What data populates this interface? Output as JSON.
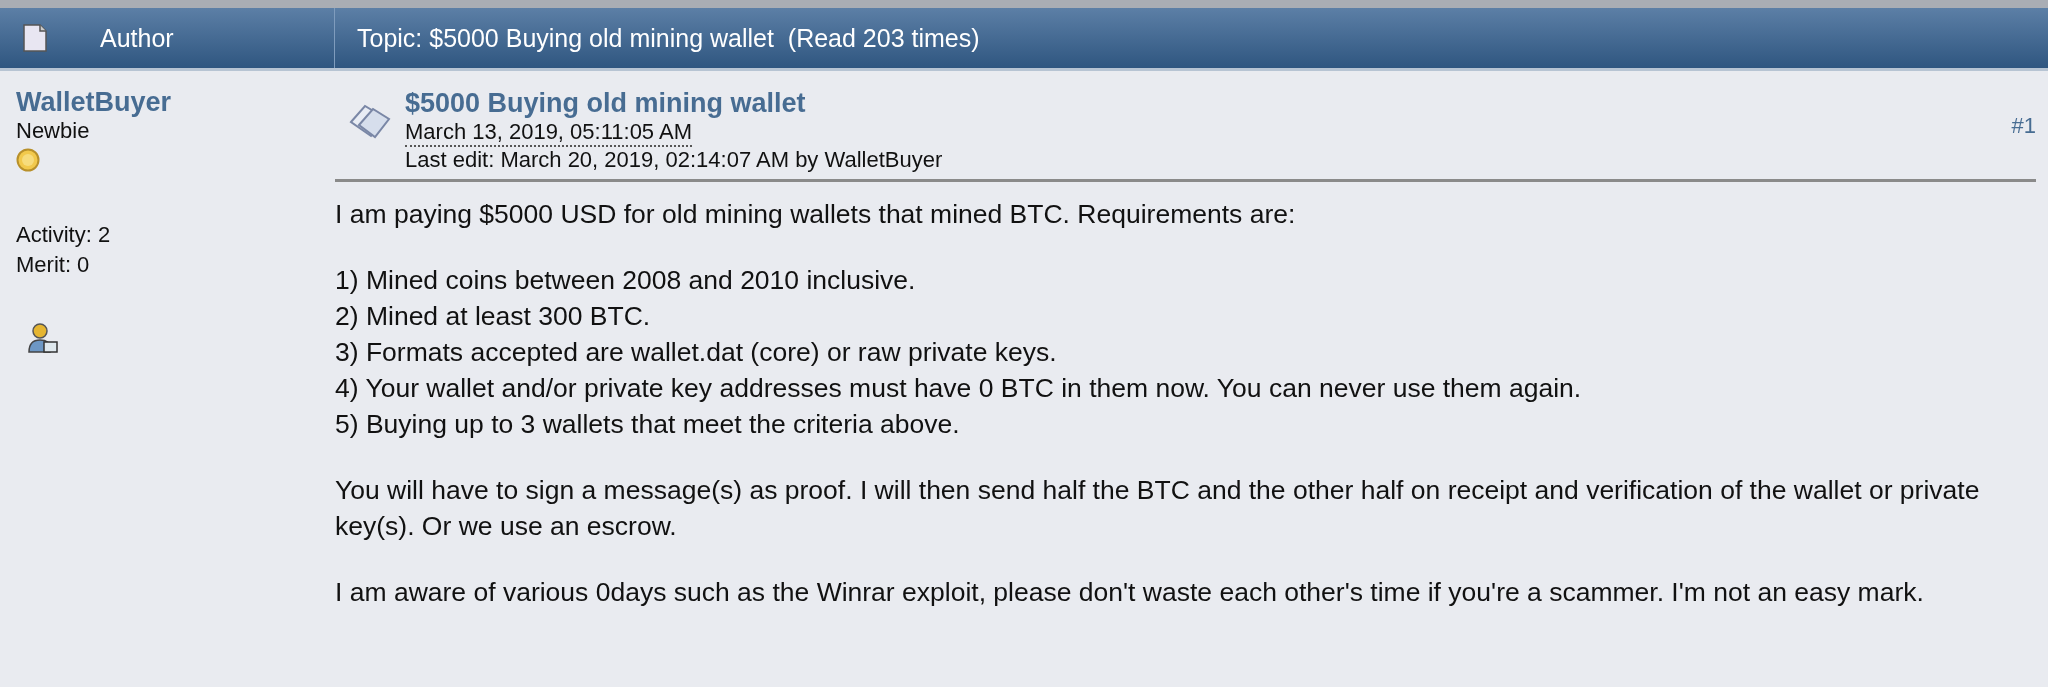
{
  "header": {
    "author_label": "Author",
    "topic_label": "Topic: $5000 Buying old mining wallet  (Read 203 times)"
  },
  "author": {
    "name": "WalletBuyer",
    "rank": "Newbie",
    "activity": "Activity: 2",
    "merit": "Merit: 0"
  },
  "post": {
    "title": "$5000 Buying old mining wallet",
    "date": "March 13, 2019, 05:11:05 AM",
    "last_edit": "Last edit: March 20, 2019, 02:14:07 AM by WalletBuyer",
    "number": "#1",
    "body": [
      {
        "kind": "paragraph",
        "text": "I am paying $5000 USD for old mining wallets that mined BTC. Requirements are:"
      },
      {
        "kind": "list",
        "items": [
          "1) Mined coins between 2008 and 2010 inclusive.",
          "2) Mined at least 300 BTC.",
          "3) Formats accepted are wallet.dat (core) or raw private keys.",
          "4) Your wallet and/or private key addresses must have 0 BTC in them now. You can never use them again.",
          "5) Buying up to 3 wallets that meet the criteria above."
        ]
      },
      {
        "kind": "paragraph",
        "text": "You will have to sign a message(s) as proof. I will then send half the BTC and the other half on receipt and verification of the wallet or private key(s). Or we use an escrow."
      },
      {
        "kind": "paragraph",
        "text": "I am aware of various 0days such as the Winrar exploit, please don't waste each other's time if you're a scammer. I'm not an easy mark."
      }
    ]
  }
}
